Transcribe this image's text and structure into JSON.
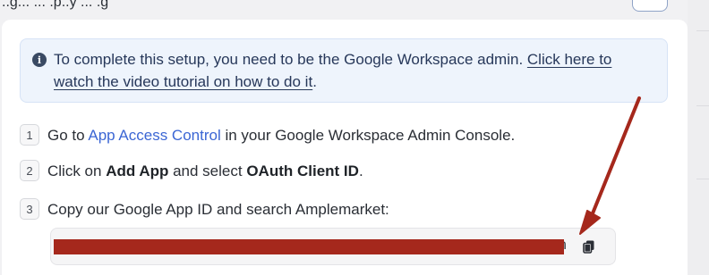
{
  "header": {
    "title_fragment": "..g...  ... .p..y ... .g"
  },
  "alert": {
    "text": "To complete this setup, you need to be the Google Workspace admin. ",
    "link": "Click here to watch the video tutorial on how to do it",
    "suffix": "."
  },
  "steps": [
    {
      "number": "1",
      "pre": "Go to ",
      "link": "App Access Control",
      "post": " in your Google Workspace Admin Console."
    },
    {
      "number": "2",
      "pre": "Click on ",
      "bold1": "Add App",
      "mid": " and select ",
      "bold2": "OAuth Client ID",
      "post": "."
    },
    {
      "number": "3",
      "text": "Copy our Google App ID and search Amplemarket:"
    }
  ],
  "app_id": {
    "visible_tail": "n",
    "redacted": true
  },
  "icons": {
    "info": "info-icon",
    "copy": "copy-icon"
  },
  "colors": {
    "link_blue": "#3b66d4",
    "alert_bg": "#eef4fc",
    "redaction": "#a5281c"
  }
}
